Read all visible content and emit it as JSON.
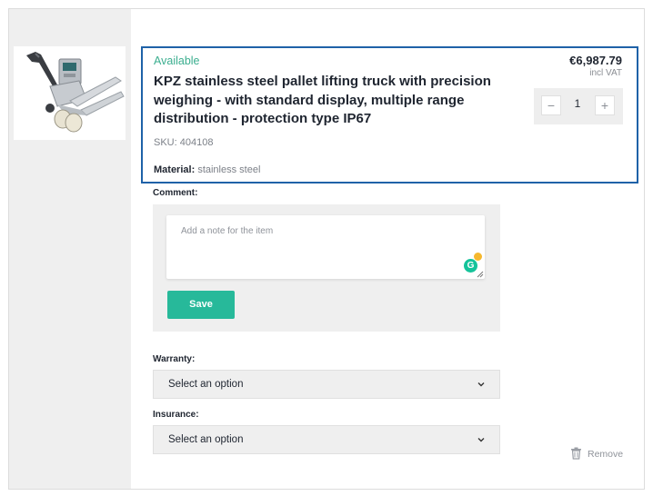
{
  "product": {
    "status": "Available",
    "title": "KPZ stainless steel pallet lifting truck with precision weighing - with standard display, multiple range distribution - protection type IP67",
    "sku": "SKU: 404108",
    "material_label": "Material:",
    "material_value": "stainless steel",
    "price": "€6,987.79",
    "vat_note": "incl VAT",
    "image_icon": "pallet-truck-image"
  },
  "quantity": {
    "minus": "−",
    "value": "1",
    "plus": "+"
  },
  "comment": {
    "label": "Comment:",
    "placeholder": "Add a note for the item",
    "save_label": "Save",
    "grammarly_glyph": "G"
  },
  "warranty": {
    "label": "Warranty:",
    "selected": "Select an option"
  },
  "insurance": {
    "label": "Insurance:",
    "selected": "Select an option"
  },
  "actions": {
    "remove_label": "Remove",
    "remove_icon": "trash-icon"
  },
  "colors": {
    "accent_green": "#27b99a",
    "status_green": "#3bae8f",
    "card_border_blue": "#1f62a8",
    "panel_gray": "#efefef"
  }
}
